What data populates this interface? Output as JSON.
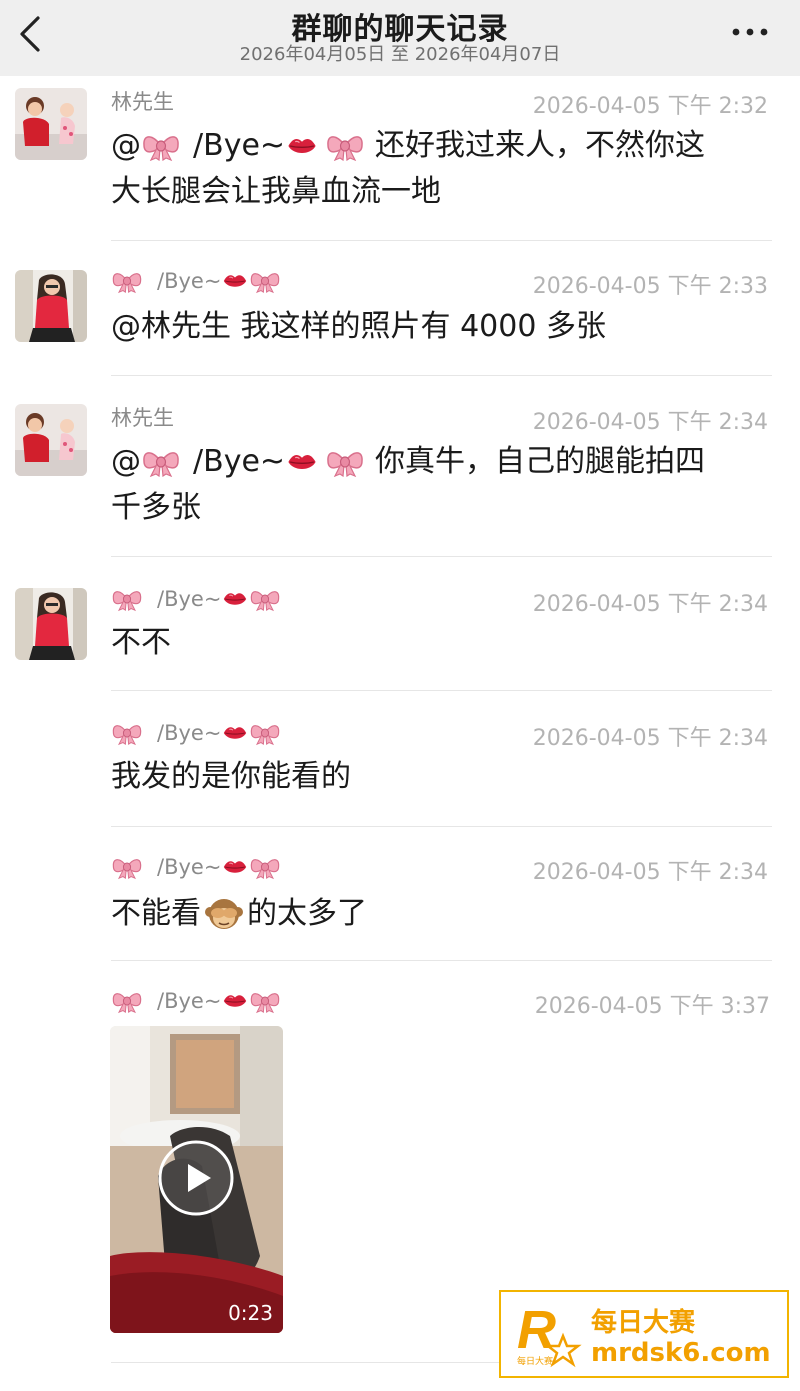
{
  "header": {
    "title": "群聊的聊天记录",
    "date_range": "2026年04月05日 至 2026年04月07日"
  },
  "colors": {
    "bow": "#f0a0b4",
    "lips": "#d8203c",
    "watermark": "#f2a000"
  },
  "messages": [
    {
      "sender": "林先生",
      "time": "2026-04-05 下午 2:32",
      "mention": "@",
      "text": "还好我过来人，不然你这",
      "text2": "大长腿会让我鼻血流一地"
    },
    {
      "sender_suffix": "/Bye~",
      "time": "2026-04-05 下午 2:33",
      "text": "@林先生 我这样的照片有 4000 多张"
    },
    {
      "sender": "林先生",
      "time": "2026-04-05 下午 2:34",
      "mention": "@",
      "text": "你真牛，自己的腿能拍四",
      "text2": "千多张"
    },
    {
      "sender_suffix": "/Bye~",
      "time": "2026-04-05 下午 2:34",
      "text": "不不"
    },
    {
      "sender_suffix": "/Bye~",
      "time": "2026-04-05 下午 2:34",
      "text": "我发的是你能看的"
    },
    {
      "sender_suffix": "/Bye~",
      "time": "2026-04-05 下午 2:34",
      "text_a": "不能看",
      "emoji": "see-no-evil-monkey",
      "text_b": "的太多了"
    },
    {
      "sender_suffix": "/Bye~",
      "time": "2026-04-05 下午 3:37",
      "video_duration": "0:23"
    }
  ],
  "quoted_name": "/Bye~",
  "watermark": {
    "logo_letter": "R",
    "logo_small": "每日大赛",
    "name": "每日大赛",
    "url": "mrdsk6.com"
  }
}
